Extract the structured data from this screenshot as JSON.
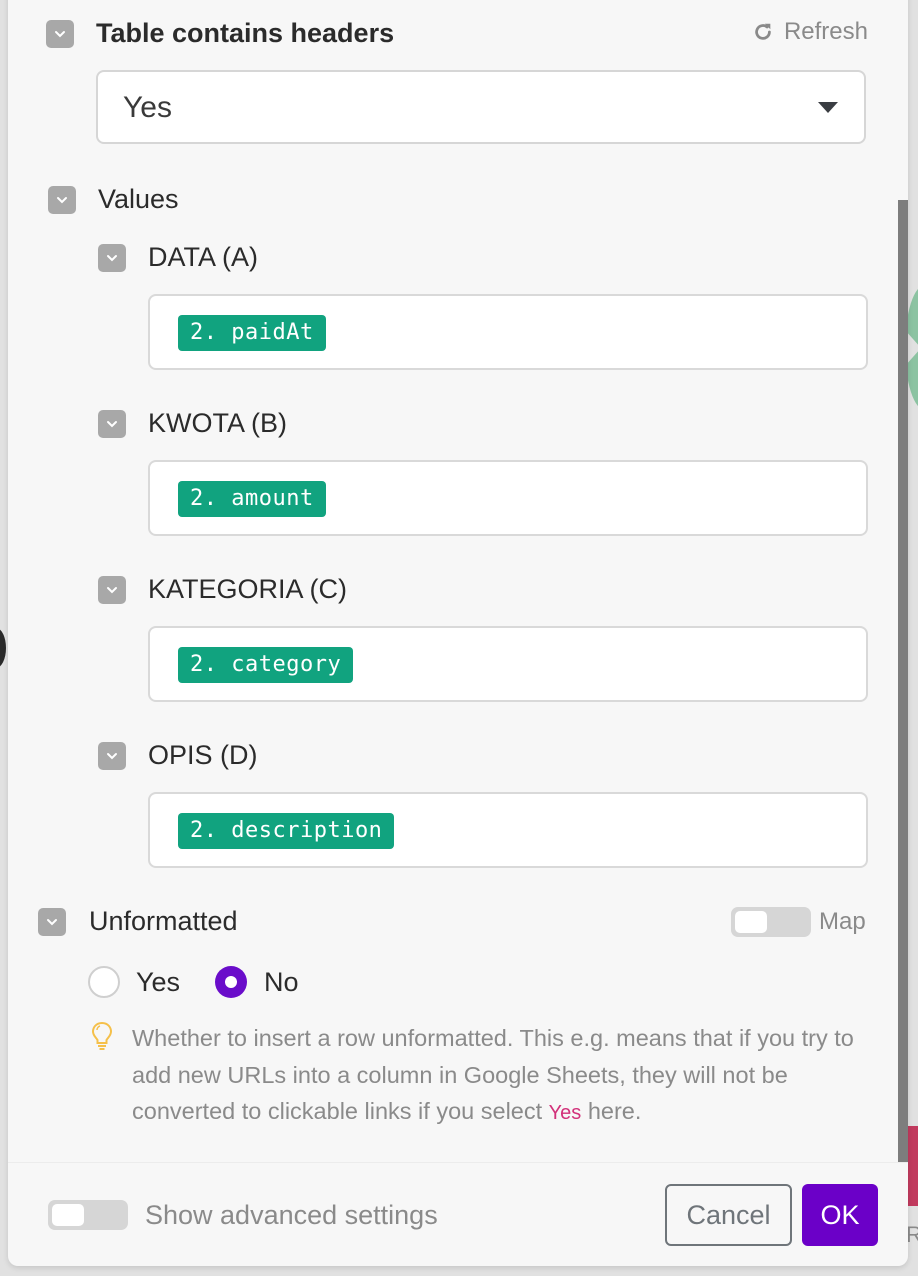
{
  "table_headers": {
    "label": "Table contains headers",
    "refresh_label": "Refresh",
    "selected_value": "Yes"
  },
  "values": {
    "label": "Values",
    "columns": [
      {
        "label": "DATA (A)",
        "value": "2. paidAt"
      },
      {
        "label": "KWOTA (B)",
        "value": "2. amount"
      },
      {
        "label": "KATEGORIA (C)",
        "value": "2. category"
      },
      {
        "label": "OPIS (D)",
        "value": "2. description"
      }
    ]
  },
  "unformatted": {
    "label": "Unformatted",
    "map_label": "Map",
    "map_enabled": false,
    "options": [
      {
        "label": "Yes",
        "selected": false
      },
      {
        "label": "No",
        "selected": true
      }
    ],
    "hint_before": "Whether to insert a row unformatted. This e.g. means that if you try to add new URLs into a column in Google Sheets, they will not be converted to clickable links if you select ",
    "hint_highlight": "Yes",
    "hint_after": " here."
  },
  "footer": {
    "advanced_label": "Show advanced settings",
    "advanced_enabled": false,
    "cancel_label": "Cancel",
    "ok_label": "OK"
  },
  "colors": {
    "accent": "#6b00c8",
    "pill": "#11a37f",
    "hint_highlight": "#d2317a",
    "hint_icon": "#f5c04a"
  }
}
